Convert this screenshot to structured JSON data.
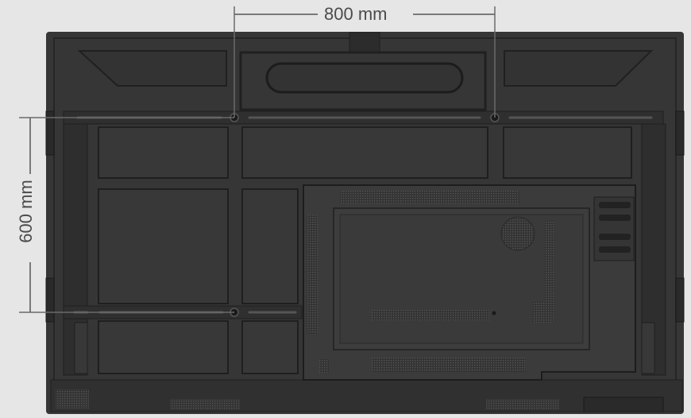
{
  "dimensions": {
    "width_label": "800 mm",
    "height_label": "600 mm"
  },
  "colors": {
    "background": "#e6e6e6",
    "panel": "#363636",
    "panel_dark": "#2a2a2a",
    "rib": "#1f1f1f",
    "dimension_line": "#555555"
  }
}
